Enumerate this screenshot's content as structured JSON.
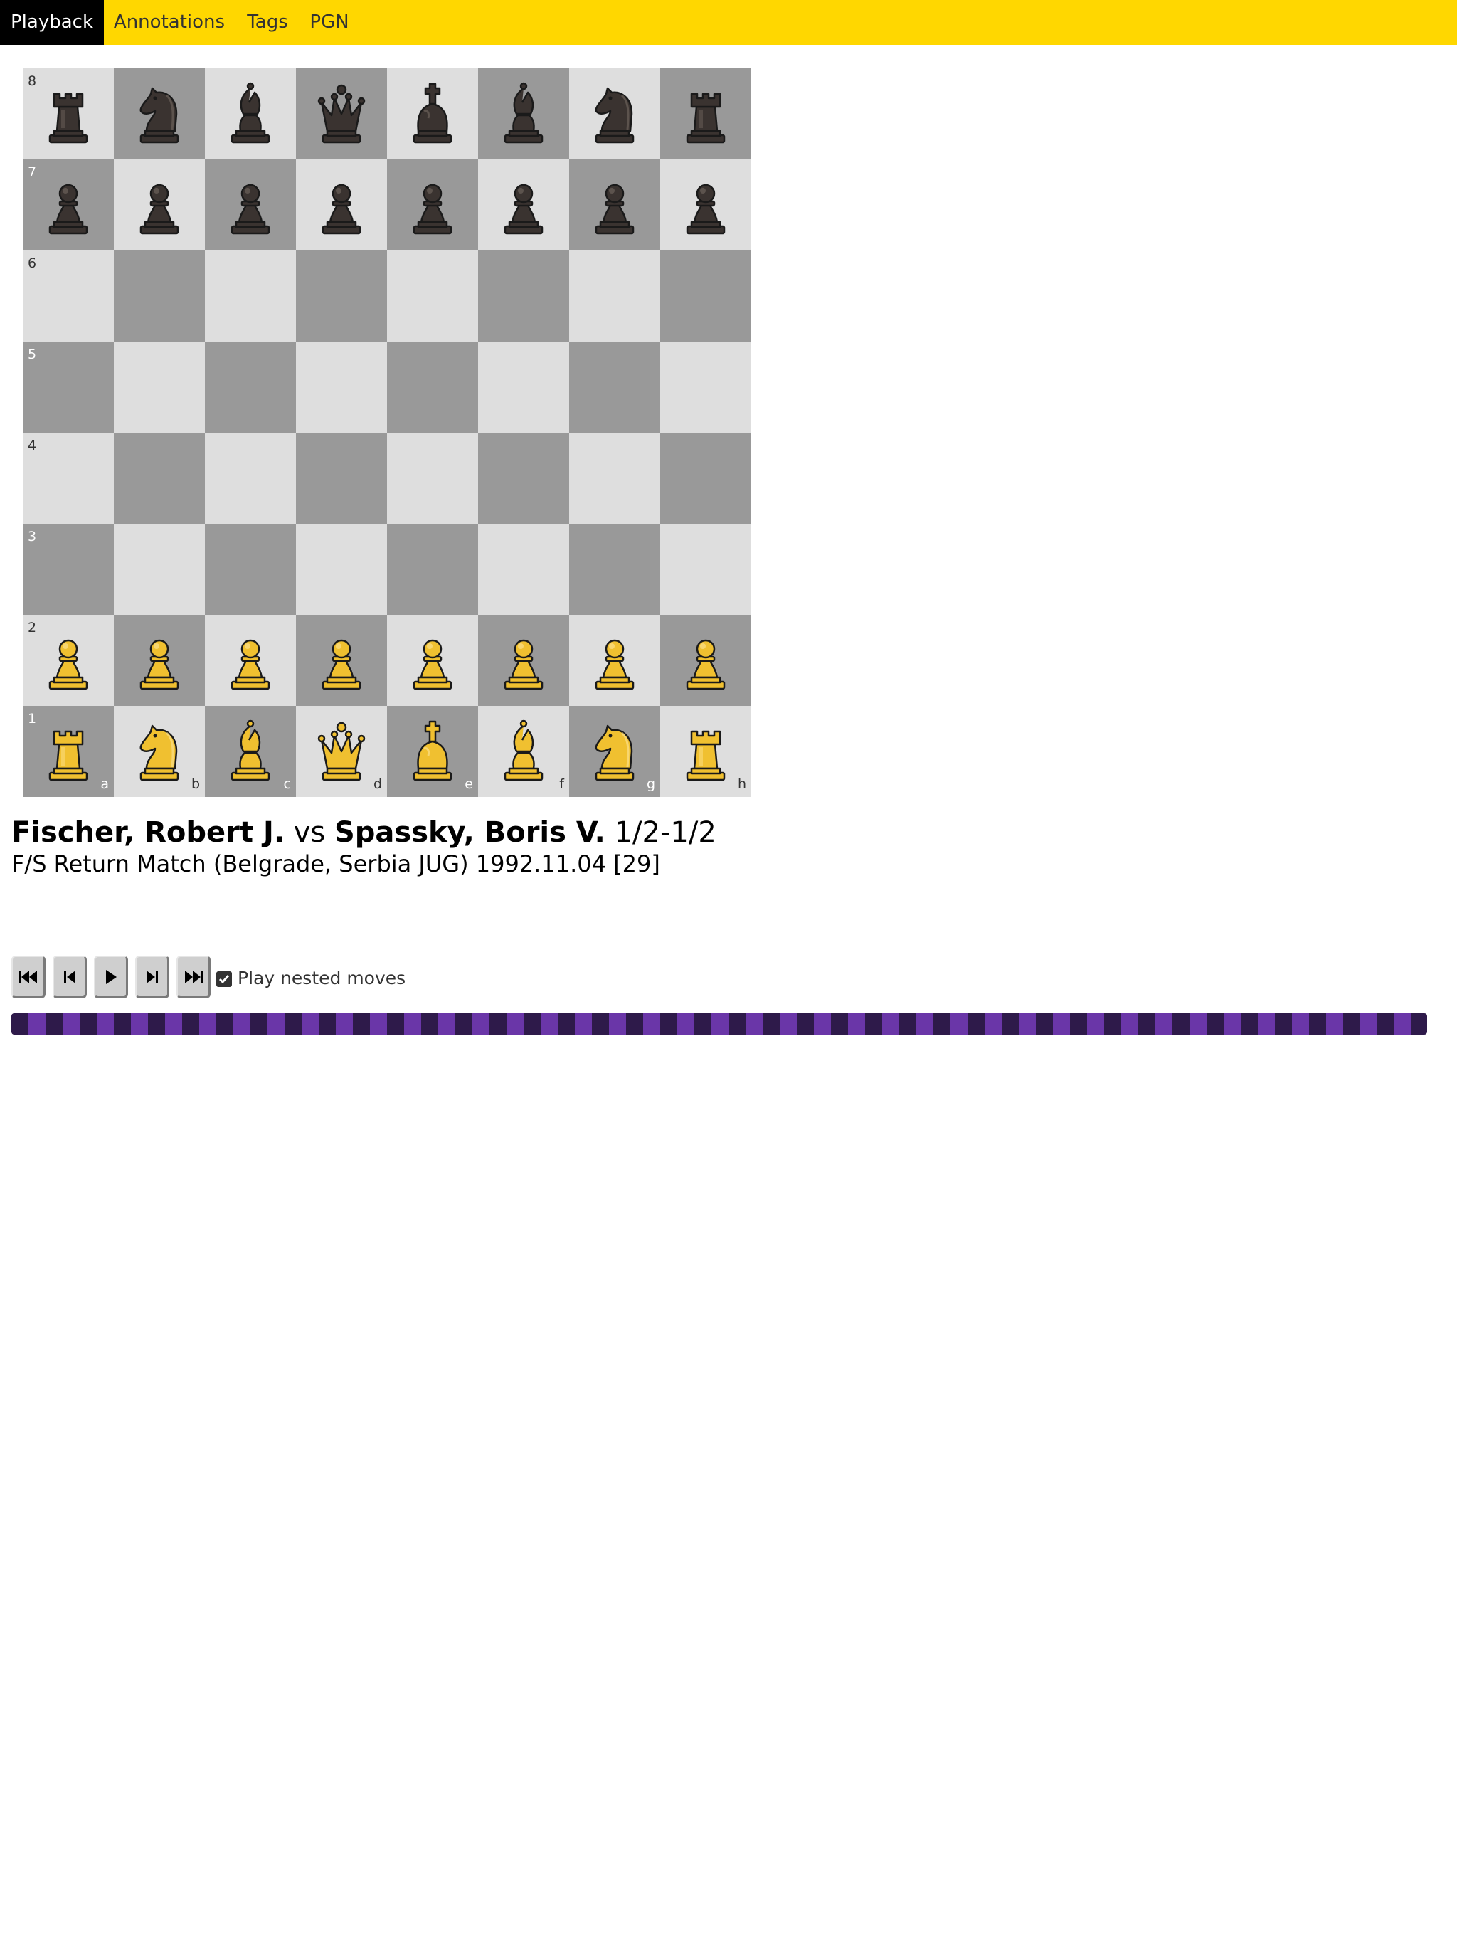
{
  "nav": {
    "tabs": [
      {
        "label": "Playback",
        "active": true
      },
      {
        "label": "Annotations",
        "active": false
      },
      {
        "label": "Tags",
        "active": false
      },
      {
        "label": "PGN",
        "active": false
      }
    ]
  },
  "board": {
    "ranks": [
      "8",
      "7",
      "6",
      "5",
      "4",
      "3",
      "2",
      "1"
    ],
    "files": [
      "a",
      "b",
      "c",
      "d",
      "e",
      "f",
      "g",
      "h"
    ],
    "position": [
      [
        "r",
        "n",
        "b",
        "q",
        "k",
        "b",
        "n",
        "r"
      ],
      [
        "p",
        "p",
        "p",
        "p",
        "p",
        "p",
        "p",
        "p"
      ],
      [
        "",
        "",
        "",
        "",
        "",
        "",
        "",
        ""
      ],
      [
        "",
        "",
        "",
        "",
        "",
        "",
        "",
        ""
      ],
      [
        "",
        "",
        "",
        "",
        "",
        "",
        "",
        ""
      ],
      [
        "",
        "",
        "",
        "",
        "",
        "",
        "",
        ""
      ],
      [
        "P",
        "P",
        "P",
        "P",
        "P",
        "P",
        "P",
        "P"
      ],
      [
        "R",
        "N",
        "B",
        "Q",
        "K",
        "B",
        "N",
        "R"
      ]
    ],
    "colors": {
      "light_square": "#dedede",
      "dark_square": "#999999",
      "white_piece": "#f0c030",
      "black_piece": "#3a3330"
    }
  },
  "game": {
    "white": "Fischer, Robert J.",
    "vs": "vs",
    "black": "Spassky, Boris V.",
    "result": "1/2-1/2",
    "event_line": "F/S Return Match (Belgrade, Serbia JUG) 1992.11.04 [29]"
  },
  "controls": {
    "buttons": [
      {
        "name": "first-move",
        "icon": "skip-to-start-icon"
      },
      {
        "name": "previous-move",
        "icon": "step-back-icon"
      },
      {
        "name": "play",
        "icon": "play-icon"
      },
      {
        "name": "next-move",
        "icon": "step-forward-icon"
      },
      {
        "name": "last-move",
        "icon": "skip-to-end-icon"
      }
    ],
    "play_nested_label": "Play nested moves",
    "play_nested_checked": true
  },
  "progress": {
    "colors": [
      "#2e1a4a",
      "#6a36a8"
    ]
  }
}
